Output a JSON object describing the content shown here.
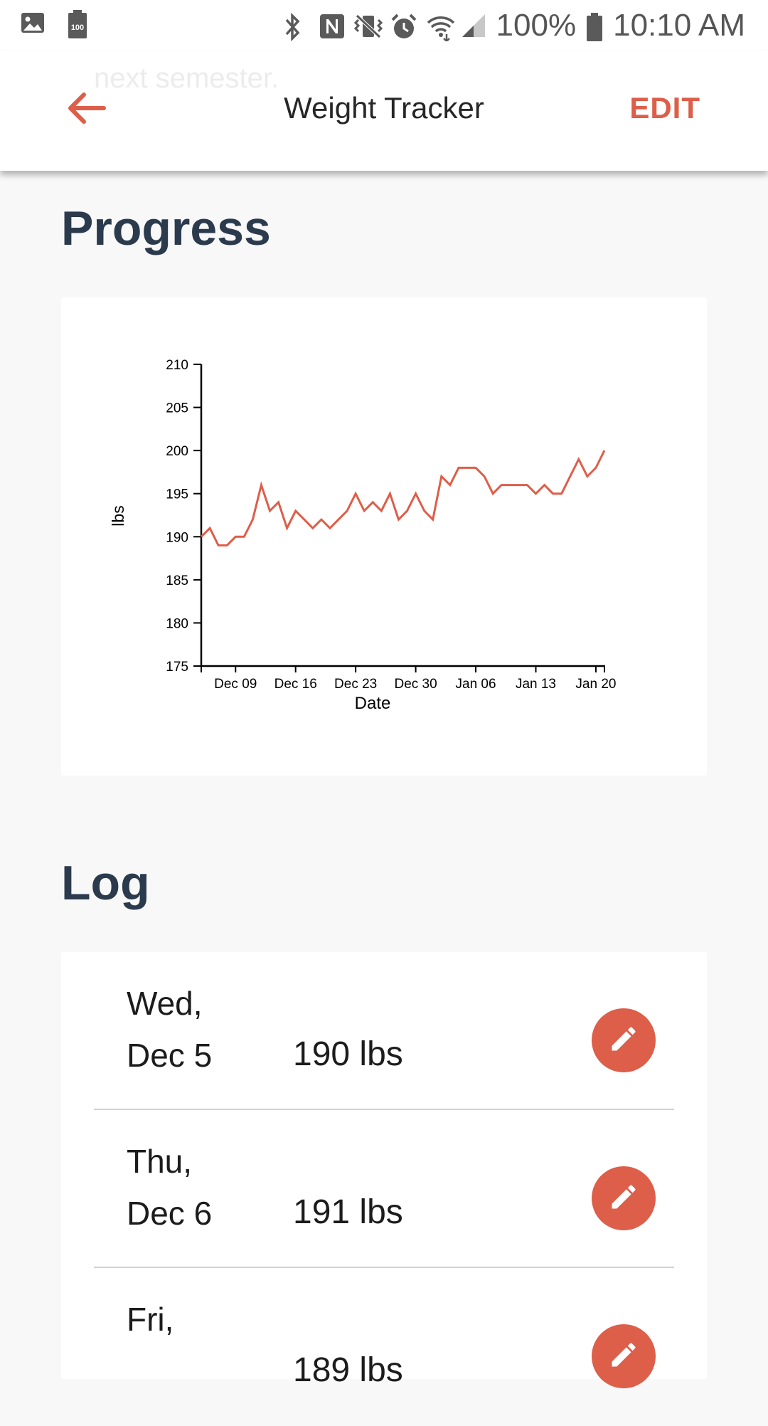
{
  "status_bar": {
    "battery_percent": "100%",
    "time": "10:10 AM",
    "left_icons": [
      "image-icon",
      "battery-saver-100-icon"
    ],
    "right_icons": [
      "bluetooth-icon",
      "nfc-icon",
      "vibrate-icon",
      "alarm-icon",
      "wifi-icon",
      "cell-signal-icon",
      "battery-icon"
    ]
  },
  "app_bar": {
    "ghost_text": "next semester.",
    "title": "Weight Tracker",
    "edit_label": "EDIT",
    "back_icon": "arrow-left-icon"
  },
  "colors": {
    "accent": "#dd5e49",
    "heading": "#2b3a4c",
    "background": "#f8f8f8",
    "card": "#ffffff"
  },
  "progress": {
    "heading": "Progress"
  },
  "chart_data": {
    "type": "line",
    "xlabel": "Date",
    "ylabel": "lbs",
    "ylim": [
      175,
      210
    ],
    "yticks": [
      175,
      180,
      185,
      190,
      195,
      200,
      205,
      210
    ],
    "xlim": [
      "2018-12-05",
      "2019-01-21"
    ],
    "xtick_labels": [
      "Dec 09",
      "Dec 16",
      "Dec 23",
      "Dec 30",
      "Jan 06",
      "Jan 13",
      "Jan 20"
    ],
    "grid": false,
    "series": [
      {
        "color": "#dd5e49",
        "x": [
          "2018-12-05",
          "2018-12-06",
          "2018-12-07",
          "2018-12-08",
          "2018-12-09",
          "2018-12-10",
          "2018-12-11",
          "2018-12-12",
          "2018-12-13",
          "2018-12-14",
          "2018-12-15",
          "2018-12-16",
          "2018-12-17",
          "2018-12-18",
          "2018-12-19",
          "2018-12-20",
          "2018-12-21",
          "2018-12-22",
          "2018-12-23",
          "2018-12-24",
          "2018-12-25",
          "2018-12-26",
          "2018-12-27",
          "2018-12-28",
          "2018-12-29",
          "2018-12-30",
          "2018-12-31",
          "2019-01-01",
          "2019-01-02",
          "2019-01-03",
          "2019-01-04",
          "2019-01-05",
          "2019-01-06",
          "2019-01-07",
          "2019-01-08",
          "2019-01-09",
          "2019-01-10",
          "2019-01-11",
          "2019-01-12",
          "2019-01-13",
          "2019-01-14",
          "2019-01-15",
          "2019-01-16",
          "2019-01-17",
          "2019-01-18",
          "2019-01-19",
          "2019-01-20",
          "2019-01-21"
        ],
        "values": [
          190,
          191,
          189,
          189,
          190,
          190,
          192,
          196,
          193,
          194,
          191,
          193,
          192,
          191,
          192,
          191,
          192,
          193,
          195,
          193,
          194,
          193,
          195,
          192,
          193,
          195,
          193,
          192,
          197,
          196,
          198,
          198,
          198,
          197,
          195,
          196,
          196,
          196,
          196,
          195,
          196,
          195,
          195,
          197,
          199,
          197,
          198,
          200
        ]
      }
    ]
  },
  "log": {
    "heading": "Log",
    "entries": [
      {
        "day": "Wed,",
        "date": "Dec 5",
        "weight": "190 lbs"
      },
      {
        "day": "Thu,",
        "date": "Dec 6",
        "weight": "191 lbs"
      },
      {
        "day": "Fri,",
        "date": "",
        "weight": "189 lbs"
      }
    ],
    "edit_icon": "pencil-icon"
  }
}
